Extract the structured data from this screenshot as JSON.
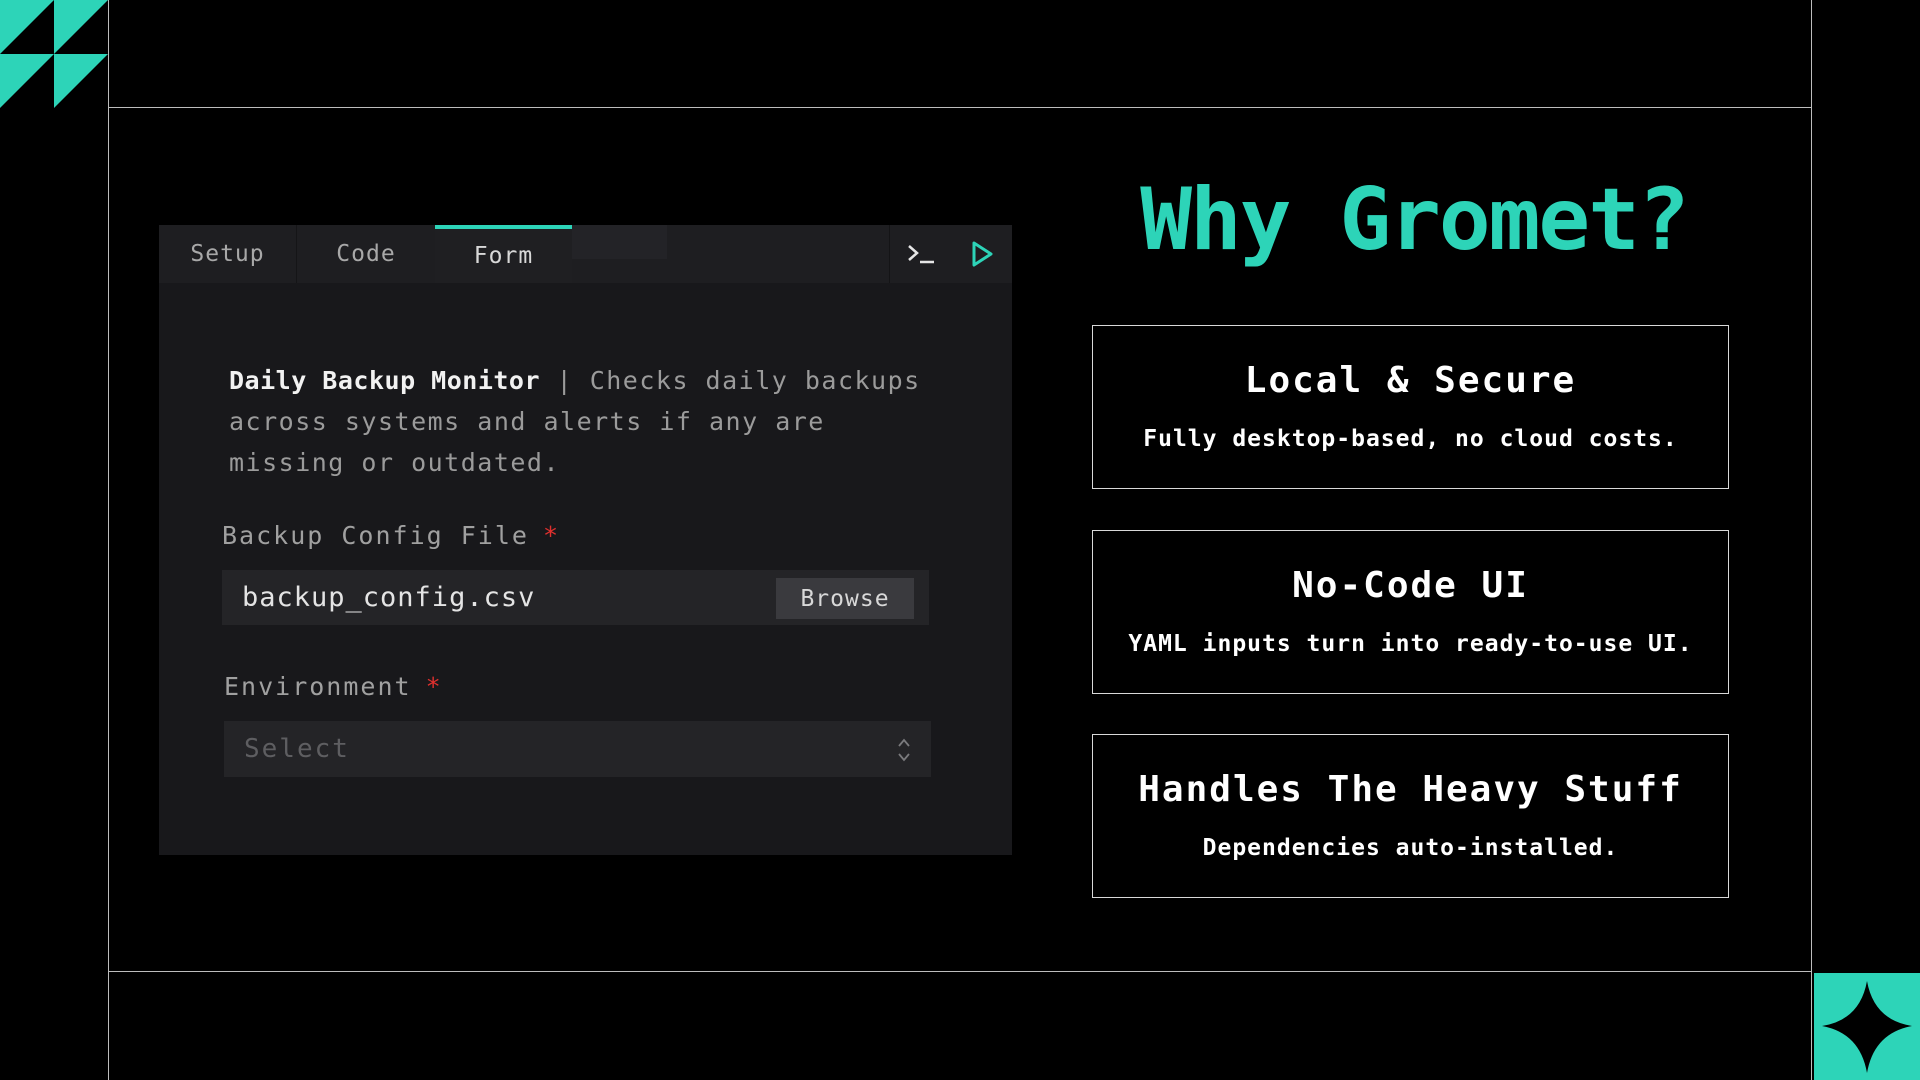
{
  "colors": {
    "accent": "#2dd4b8",
    "background": "#000000",
    "panel": "#18181b",
    "required": "#e0302e"
  },
  "app": {
    "tabs": [
      "Setup",
      "Code",
      "Form"
    ],
    "active_tab": "Form",
    "terminal_icon": "terminal-icon",
    "run_icon": "play-icon",
    "description": {
      "title": "Daily Backup Monitor",
      "separator": " | ",
      "text": "Checks daily backups across systems and alerts if any are missing or outdated."
    },
    "fields": {
      "config_file": {
        "label": "Backup Config File",
        "required_mark": "*",
        "value": "backup_config.csv",
        "browse_label": "Browse"
      },
      "environment": {
        "label": "Environment",
        "required_mark": "*",
        "placeholder": "Select",
        "icon": "chevron-updown-icon"
      }
    }
  },
  "headline": "Why Gromet?",
  "features": [
    {
      "title": "Local & Secure",
      "text": "Fully desktop-based, no cloud costs."
    },
    {
      "title": "No-Code UI",
      "text": "YAML inputs turn into ready-to-use UI."
    },
    {
      "title": "Handles The Heavy Stuff",
      "text": "Dependencies auto-installed."
    }
  ]
}
